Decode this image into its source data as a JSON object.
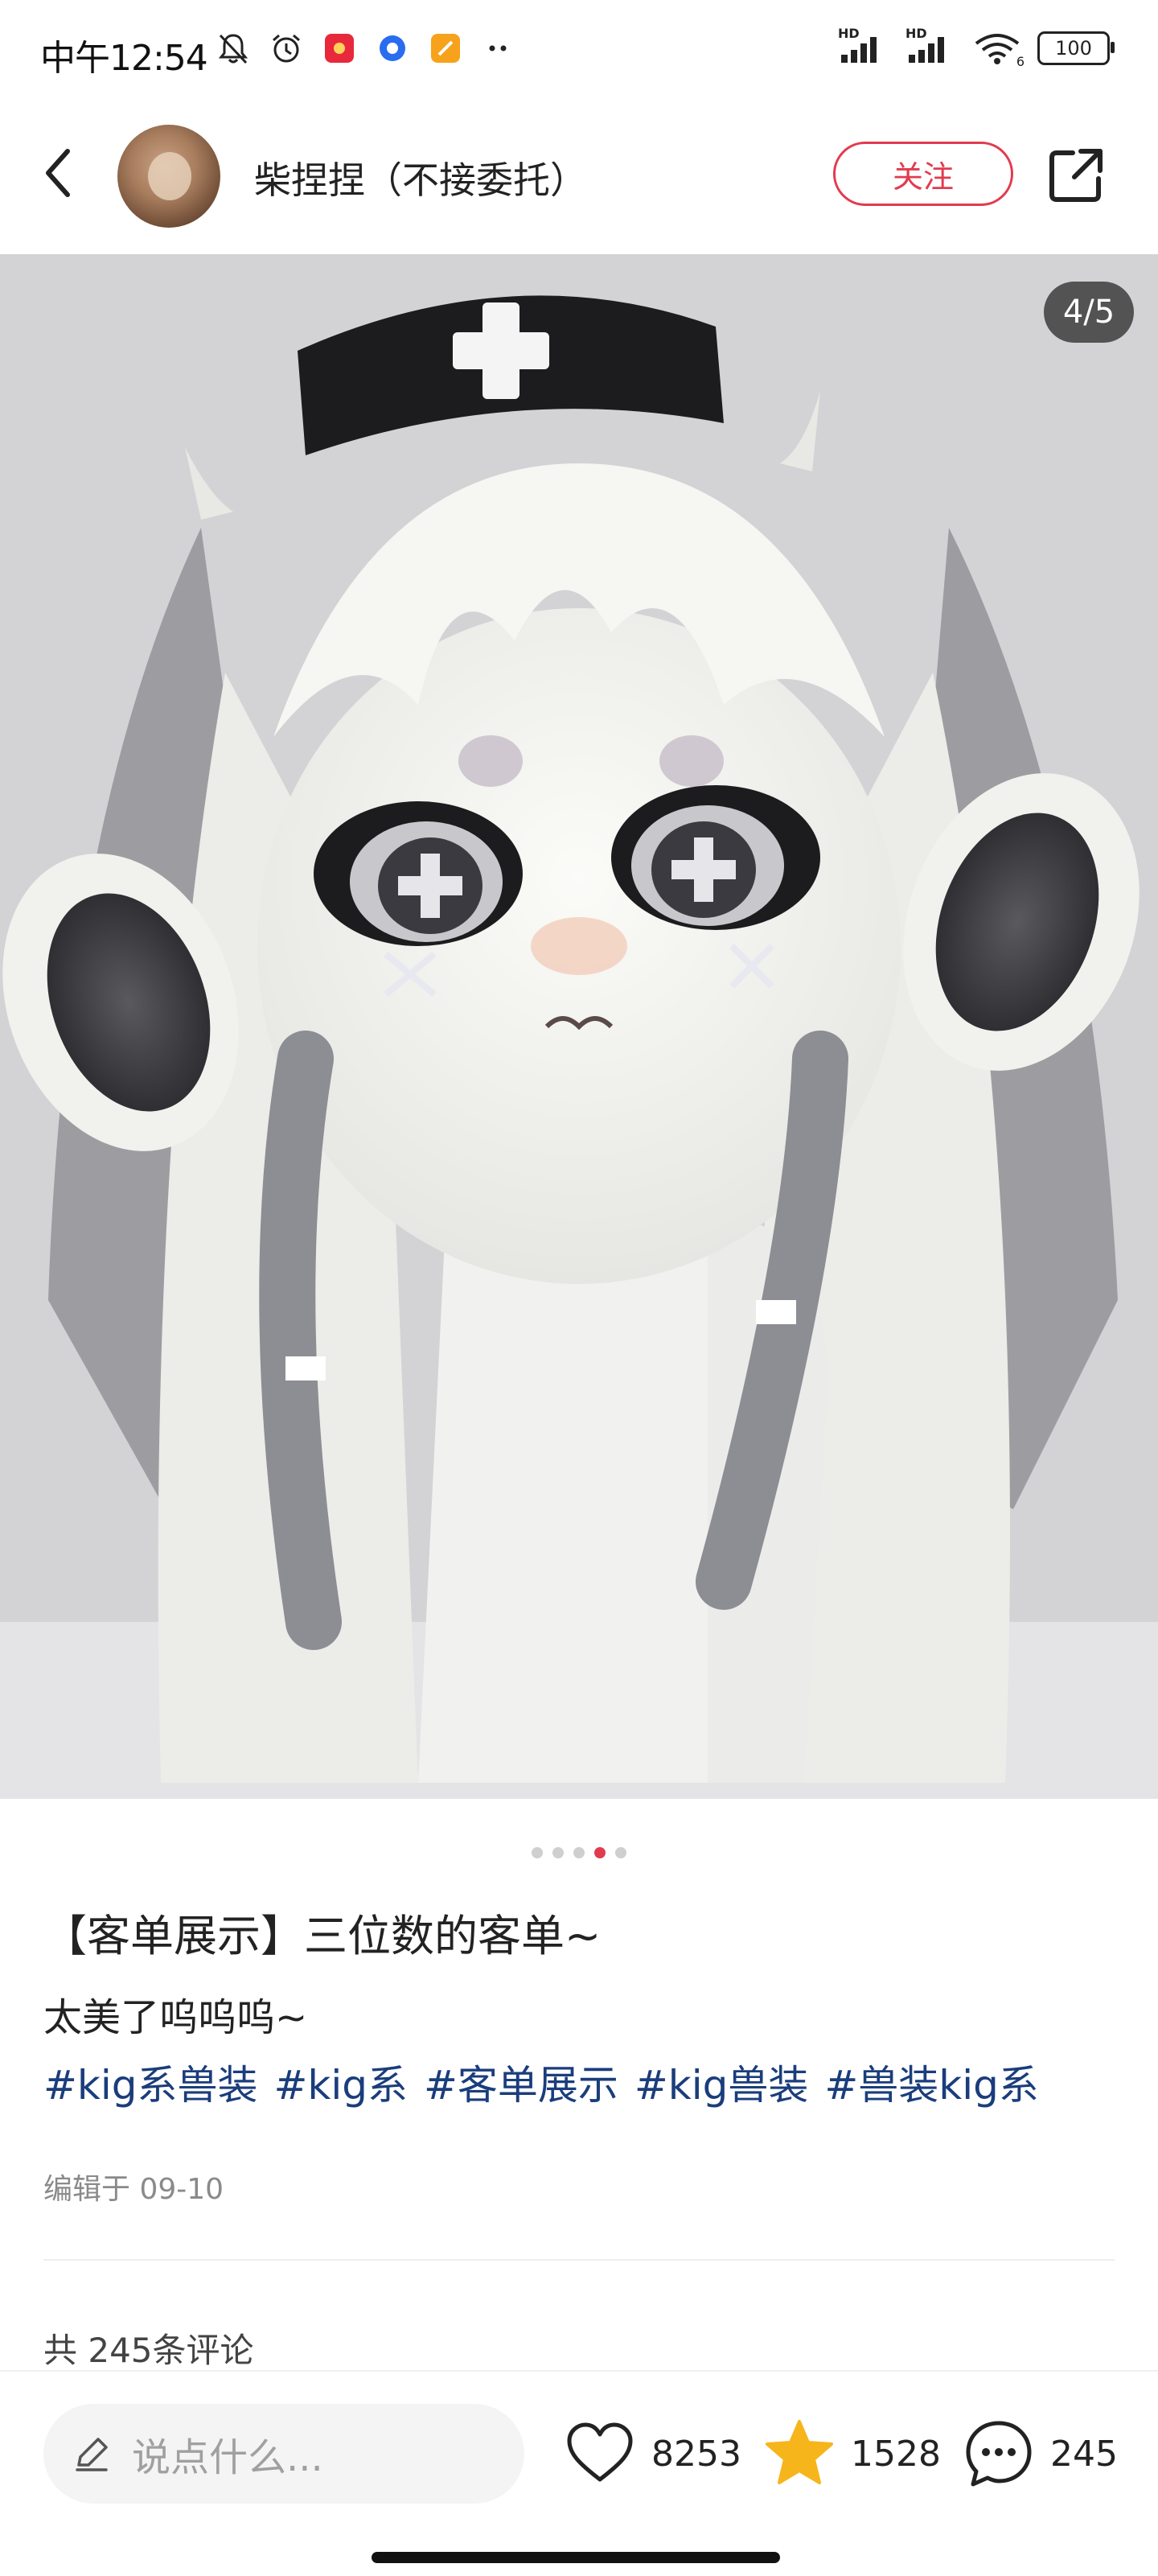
{
  "status_bar": {
    "time": "中午12:54",
    "battery": "100",
    "network_labels": [
      "HD",
      "HD"
    ],
    "wifi_badge": "6",
    "left_icons": [
      "mute-bell-icon",
      "alarm-icon",
      "red-app-icon",
      "blue-app-icon",
      "orange-app-icon",
      "more-dots-icon"
    ]
  },
  "header": {
    "author_name": "柴捏捏（不接委托）",
    "follow_label": "关注",
    "accent_color": "#e23b4f"
  },
  "photo": {
    "counter": "4/5",
    "current_index": 4,
    "total": 5
  },
  "post": {
    "title": "【客单展示】三位数的客单~",
    "description": "太美了呜呜呜~",
    "tags": [
      "#kig系兽装",
      "#kig系",
      "#客单展示",
      "#kig兽装",
      "#兽装kig系"
    ],
    "edited": "编辑于 09-10",
    "comments_summary": "共 245条评论"
  },
  "bottom_bar": {
    "comment_placeholder": "说点什么...",
    "likes": "8253",
    "collects": "1528",
    "comments": "245",
    "star_color": "#f6b51a"
  }
}
